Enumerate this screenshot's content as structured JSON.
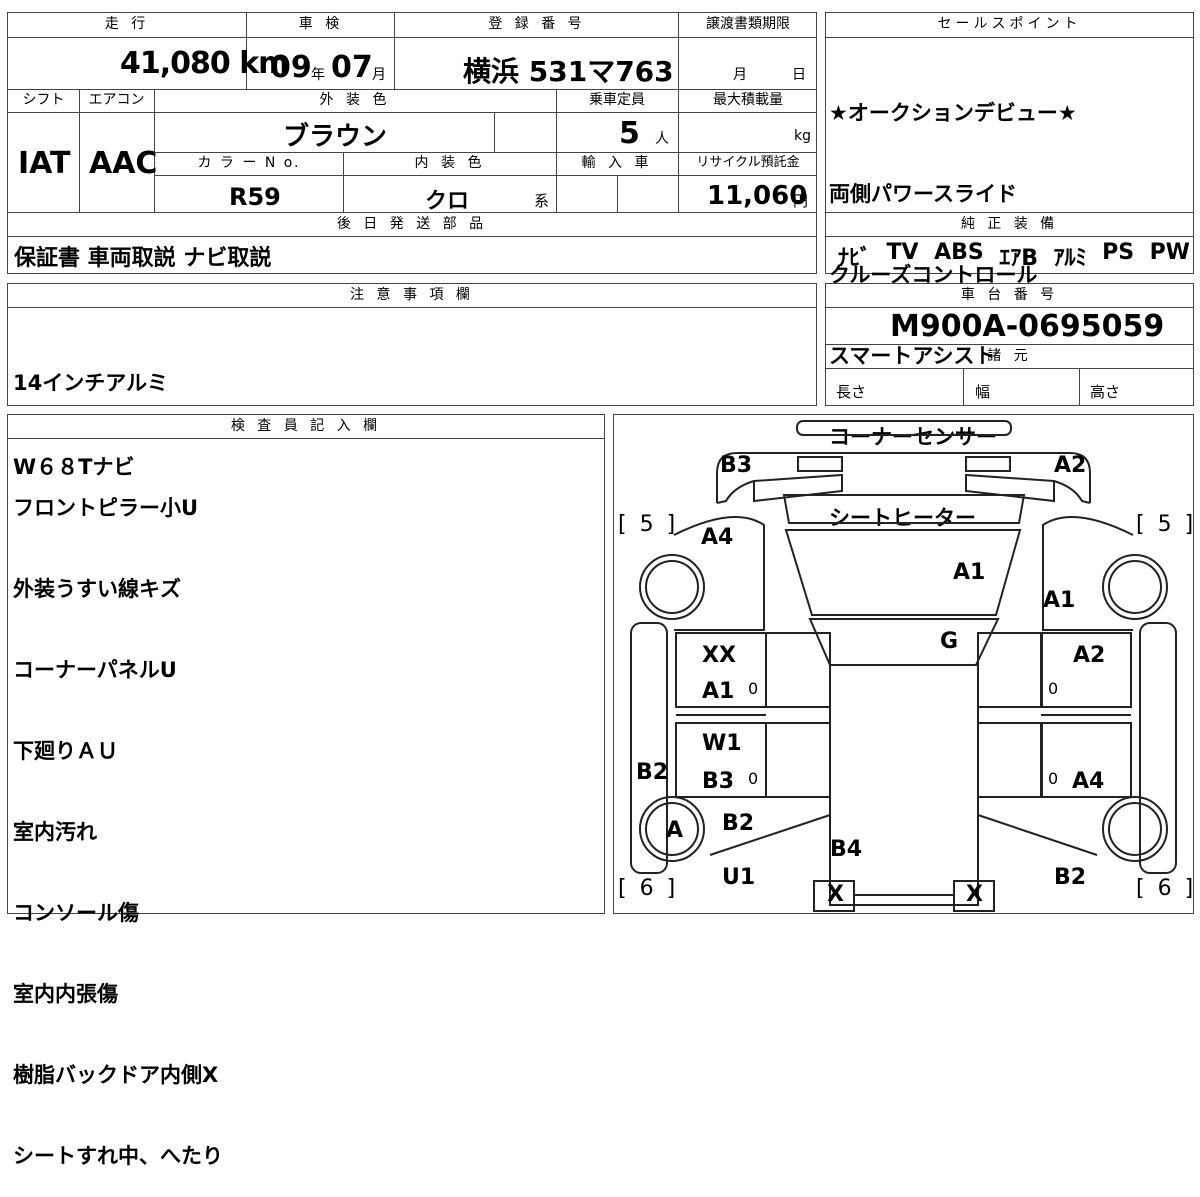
{
  "header": {
    "mileage_label": "走 行",
    "inspection_label": "車 検",
    "registration_label": "登 録 番 号",
    "transfer_deadline_label": "譲渡書類期限",
    "sales_points_label": "セールスポイント"
  },
  "values": {
    "mileage": "41,080 km",
    "inspection_year": "09",
    "inspection_year_unit": "年",
    "inspection_month": "07",
    "inspection_month_unit": "月",
    "registration_plate": "横浜 531マ763",
    "transfer_month": "月",
    "transfer_day": "日"
  },
  "row2": {
    "shift_label": "シフト",
    "aircon_label": "エアコン",
    "exterior_color_label": "外 装 色",
    "capacity_label": "乗車定員",
    "max_load_label": "最大積載量",
    "shift": "IAT",
    "aircon": "AAC",
    "exterior_color": "ブラウン",
    "capacity": "5",
    "capacity_unit": "人",
    "load_unit": "kg"
  },
  "row3": {
    "color_no_label": "カ ラ ー N o.",
    "interior_color_label": "内 装 色",
    "import_label": "輸 入 車",
    "recycle_label": "リサイクル預託金",
    "color_no": "R59",
    "interior_color": "クロ",
    "interior_suffix": "系",
    "recycle_fee": "11,060",
    "recycle_unit": "円"
  },
  "sales_points": [
    "★オークションデビュー★",
    "両側パワースライド",
    "クルーズコントロール",
    "スマートアシスト",
    "コーナーセンサー",
    "シートヒーター"
  ],
  "later_parts": {
    "label": "後 日 発 送 部 品",
    "value": "保証書 車両取説 ナビ取説"
  },
  "equipment": {
    "label": "純 正 装 備",
    "items": [
      "ﾅﾋﾞ",
      "TV",
      "ABS",
      "ｴｱB",
      "ｱﾙﾐ",
      "PS",
      "PW"
    ]
  },
  "notes": {
    "label": "注 意 事 項 欄",
    "lines": [
      "14インチアルミ",
      "W６８Tナビ"
    ]
  },
  "chassis": {
    "label": "車 台 番 号",
    "number": "M900A-0695059",
    "specs_label": "諸 元",
    "length_label": "長さ",
    "width_label": "幅",
    "height_label": "高さ"
  },
  "inspector": {
    "label": "検 査 員 記 入 欄",
    "lines": [
      "フロントピラー小U",
      "外装うすい線キズ",
      "コーナーパネルU",
      "下廻りＡＵ",
      "室内汚れ",
      "コンソール傷",
      "室内内張傷",
      "樹脂バックドア内側X",
      "シートすれ中、へたり"
    ]
  },
  "diagram": {
    "tire_front_left": "[ 5 ]",
    "tire_front_right": "[ 5 ]",
    "tire_rear_left": "[ 6 ]",
    "tire_rear_right": "[ 6 ]",
    "marks": {
      "b3_top": "B3",
      "a2_top": "A2",
      "a4_left": "A4",
      "a1_hood": "A1",
      "a1_right": "A1",
      "g_glass": "G",
      "xx_left": "XX",
      "a1_left_door": "A1",
      "a2_right": "A2",
      "w1_left": "W1",
      "b3_left": "B3",
      "b2_left": "B2",
      "a4_right": "A4",
      "a_wheel": "A",
      "b2_rear_left": "B2",
      "b4_roof": "B4",
      "u1_left": "U1",
      "b2_rear_right": "B2",
      "x_left": "X",
      "x_right": "X",
      "zero_1": "0",
      "zero_2": "0",
      "zero_3": "0",
      "zero_4": "0"
    }
  }
}
